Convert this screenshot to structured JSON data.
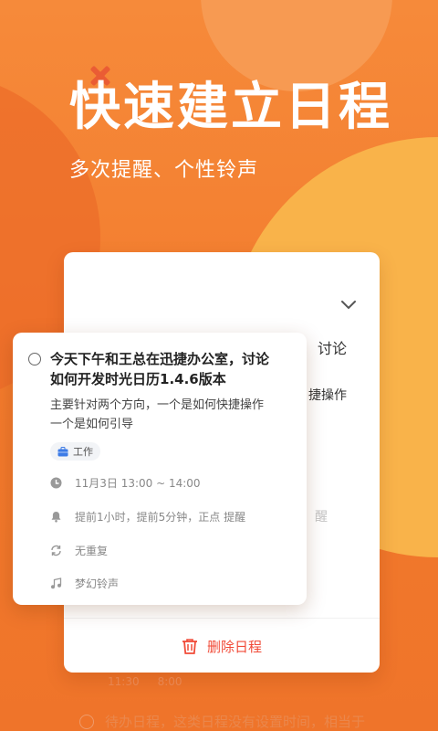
{
  "hero": {
    "title": "快速建立日程",
    "subtitle": "多次提醒、个性铃声"
  },
  "back_card": {
    "fragment_discuss": "讨论",
    "fragment_action": "捷操作",
    "fragment_remind": "醒",
    "delete_label": "删除日程"
  },
  "event": {
    "title_line1": "今天下午和王总在迅捷办公室，讨论",
    "title_line2": "如何开发时光日历1.4.6版本",
    "desc_line1": "主要针对两个方向，一个是如何快捷操作",
    "desc_line2": "一个是如何引导",
    "tag_label": "工作",
    "time": "11月3日  13:00 ~ 14:00",
    "reminder": "提前1小时，提前5分钟，正点  提醒",
    "repeat": "无重复",
    "ringtone": "梦幻铃声"
  },
  "list_below": {
    "time_a": "11:30",
    "time_b": "8:00",
    "todo_text": "待办日程，这类日程没有设置时间，相当于"
  },
  "colors": {
    "accent": "#f14b38",
    "orange": "#f27a2c",
    "yellow": "#f9b34a",
    "tag_icon": "#3c7be6"
  }
}
